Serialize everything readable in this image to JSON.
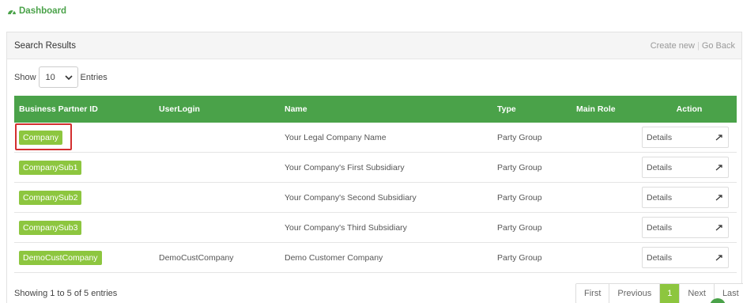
{
  "breadcrumb": {
    "label": "Dashboard",
    "icon": "dashboard-icon"
  },
  "panel": {
    "title": "Search Results",
    "create_new": "Create new",
    "go_back": "Go Back"
  },
  "length": {
    "show_label": "Show",
    "value": "10",
    "entries_label": "Entries"
  },
  "columns": [
    "Business Partner ID",
    "UserLogin",
    "Name",
    "Type",
    "Main Role",
    "Action"
  ],
  "rows": [
    {
      "id": "Company",
      "login": "",
      "name": "Your Legal Company Name",
      "type": "Party Group",
      "role": "",
      "action": "Details"
    },
    {
      "id": "CompanySub1",
      "login": "",
      "name": "Your Company's First Subsidiary",
      "type": "Party Group",
      "role": "",
      "action": "Details"
    },
    {
      "id": "CompanySub2",
      "login": "",
      "name": "Your Company's Second Subsidiary",
      "type": "Party Group",
      "role": "",
      "action": "Details"
    },
    {
      "id": "CompanySub3",
      "login": "",
      "name": "Your Company's Third Subsidiary",
      "type": "Party Group",
      "role": "",
      "action": "Details"
    },
    {
      "id": "DemoCustCompany",
      "login": "DemoCustCompany",
      "name": "Demo Customer Company",
      "type": "Party Group",
      "role": "",
      "action": "Details"
    }
  ],
  "footer": {
    "info": "Showing 1 to 5 of 5 entries"
  },
  "pagination": {
    "first": "First",
    "previous": "Previous",
    "current": "1",
    "next": "Next",
    "last": "Last"
  },
  "colors": {
    "accent": "#4aa249",
    "badge": "#8dc63f",
    "highlight": "#d32f2f"
  }
}
